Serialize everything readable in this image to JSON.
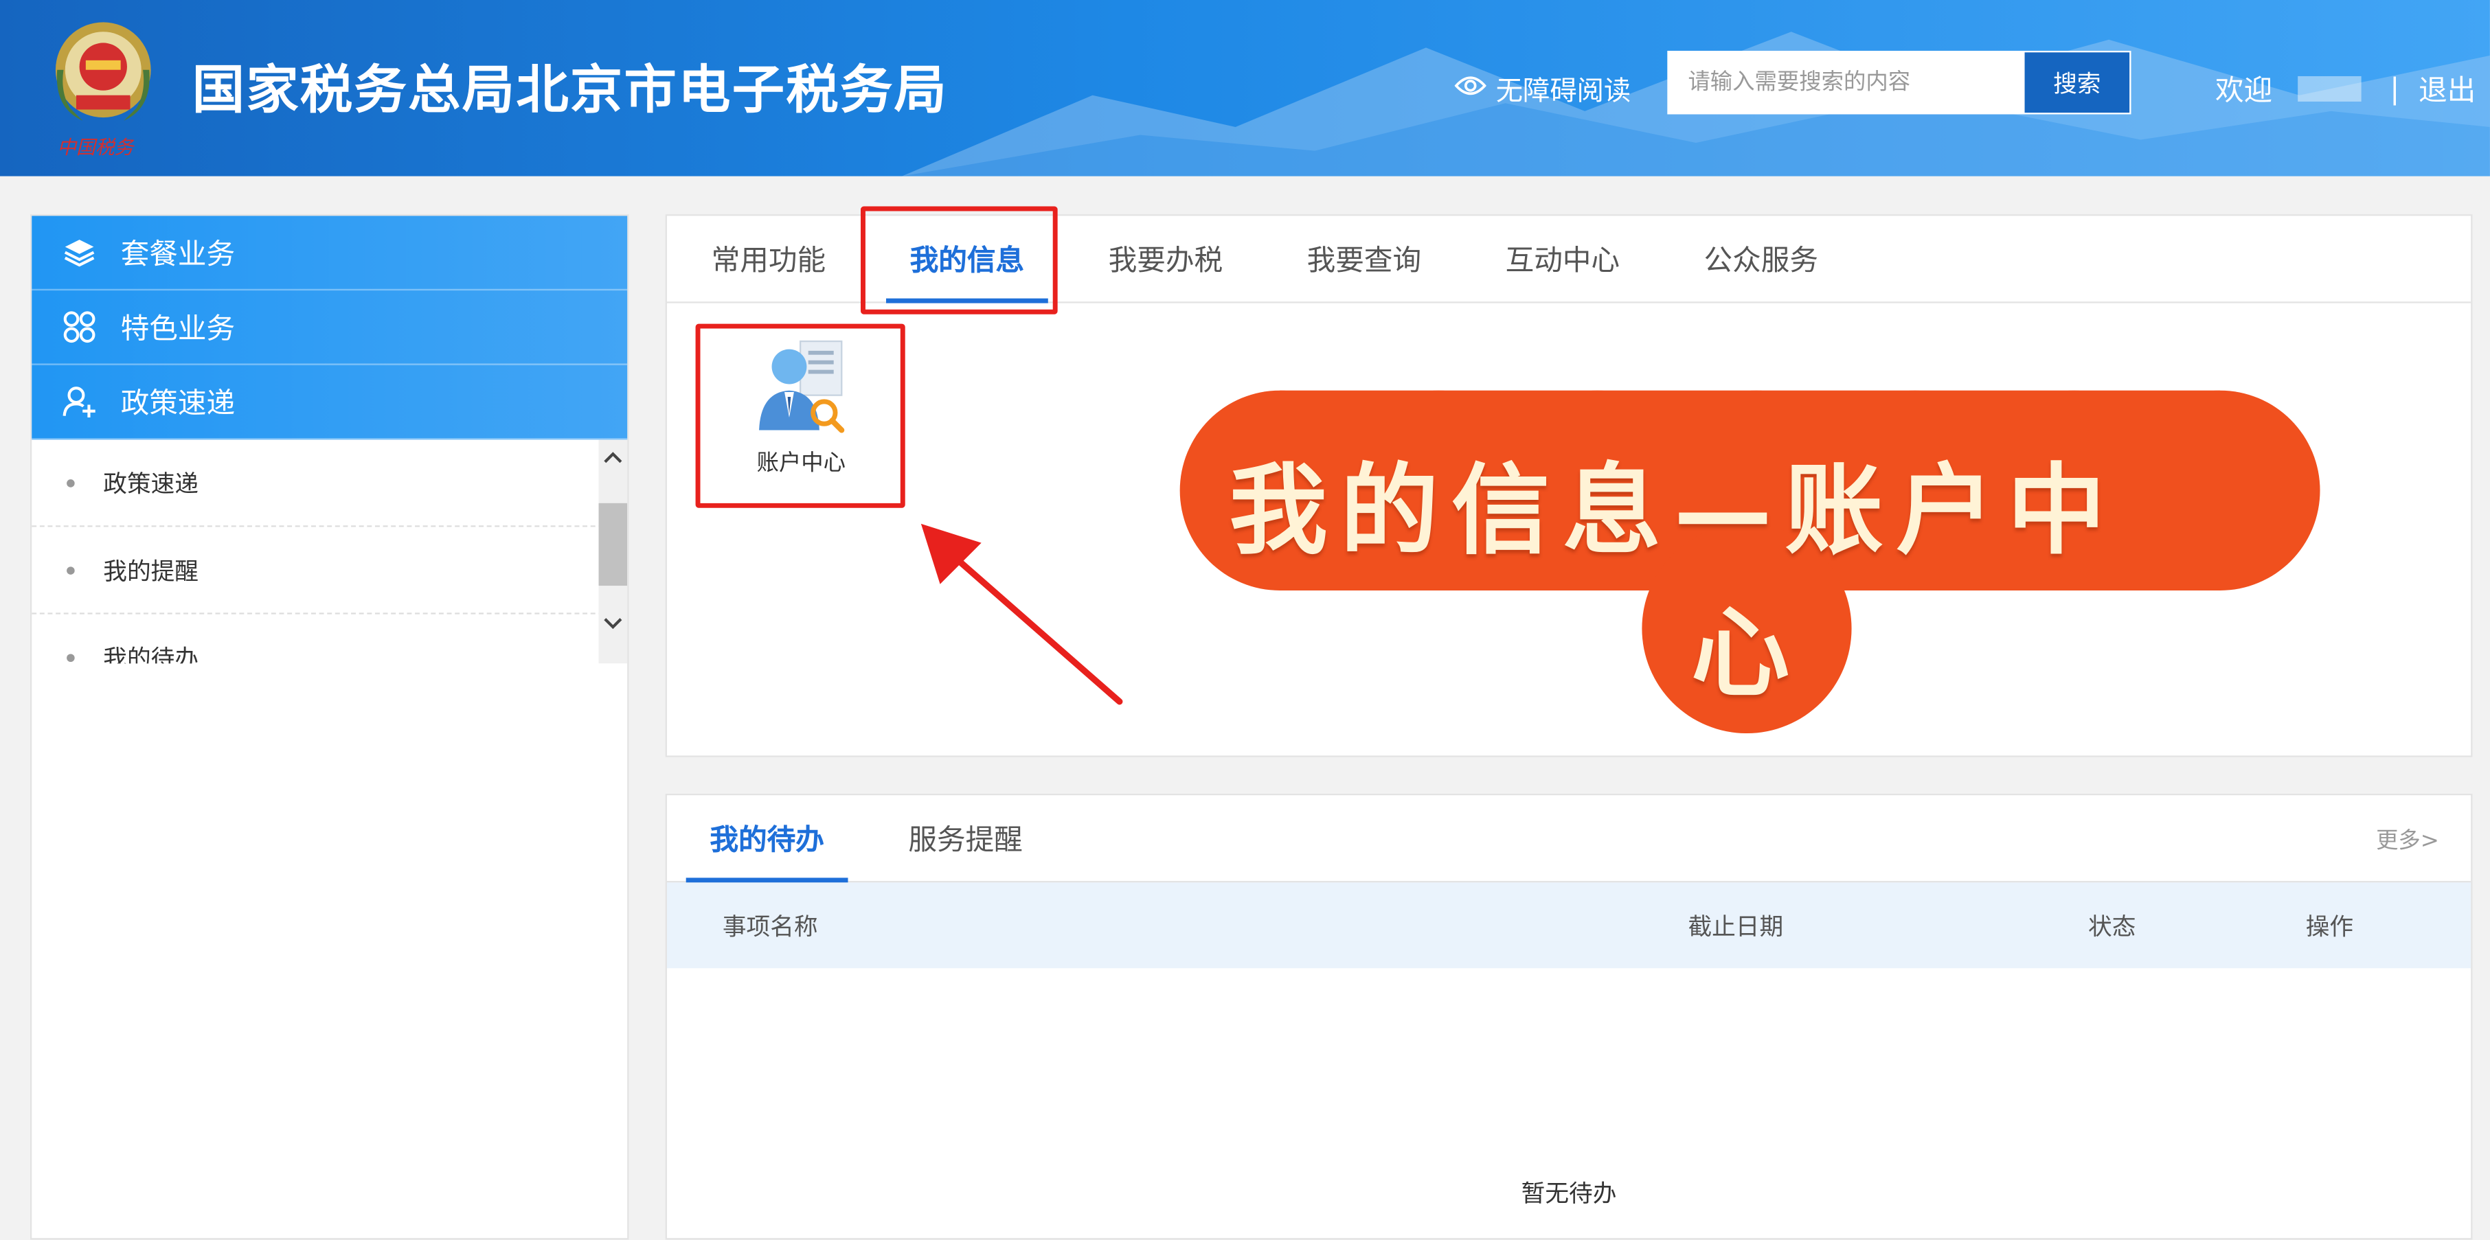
{
  "header": {
    "title": "国家税务总局北京市电子税务局",
    "emblem_caption": "中国税务",
    "accessibility_label": "无障碍阅读",
    "search": {
      "placeholder": "请输入需要搜索的内容",
      "button_label": "搜索"
    },
    "welcome_label": "欢迎",
    "separator": "|",
    "logout_label": "退出"
  },
  "sidebar": {
    "menu": [
      {
        "label": "套餐业务",
        "icon": "layers-icon"
      },
      {
        "label": "特色业务",
        "icon": "grid-icon"
      },
      {
        "label": "政策速递",
        "icon": "user-add-icon"
      }
    ],
    "sub_items": [
      {
        "label": "政策速递"
      },
      {
        "label": "我的提醒"
      },
      {
        "label": "我的待办"
      }
    ]
  },
  "main": {
    "tabs": [
      {
        "label": "常用功能",
        "active": false
      },
      {
        "label": "我的信息",
        "active": true
      },
      {
        "label": "我要办税",
        "active": false
      },
      {
        "label": "我要查询",
        "active": false
      },
      {
        "label": "互动中心",
        "active": false
      },
      {
        "label": "公众服务",
        "active": false
      }
    ],
    "account_center_label": "账户中心"
  },
  "todo": {
    "tabs": [
      {
        "label": "我的待办",
        "active": true
      },
      {
        "label": "服务提醒",
        "active": false
      }
    ],
    "more_label": "更多>",
    "columns": [
      "事项名称",
      "截止日期",
      "状态",
      "操作"
    ],
    "empty_text": "暂无待办"
  },
  "overlay": {
    "line1": "我的信息—账户中",
    "line2": "心"
  },
  "colors": {
    "header_blue": "#1565c0",
    "menu_blue": "#2196f3",
    "active_tab": "#1e6fd9",
    "highlight_red": "#e8211d",
    "banner_orange": "#f0501e"
  }
}
